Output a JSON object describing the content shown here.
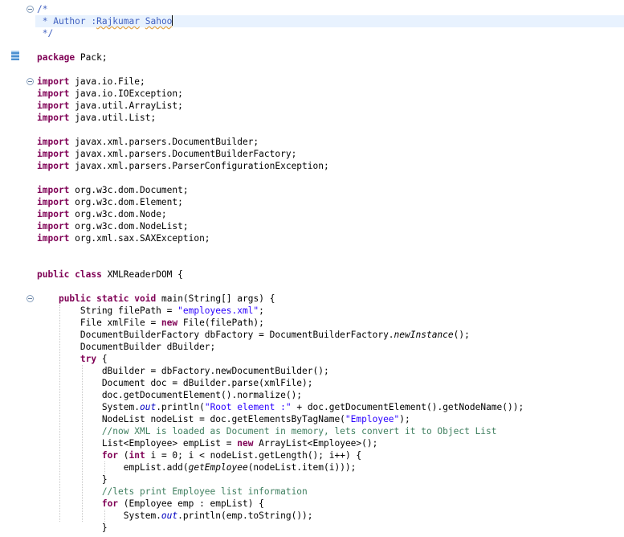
{
  "editor": {
    "lines": [
      {
        "segs": [
          {
            "t": "/*",
            "c": "jd"
          }
        ]
      },
      {
        "segs": [
          {
            "t": " * Author :",
            "c": "jd"
          },
          {
            "t": "Rajkumar",
            "c": "jd spell"
          },
          {
            "t": " ",
            "c": "jd"
          },
          {
            "t": "Sahoo",
            "c": "jd spell"
          }
        ],
        "current": true
      },
      {
        "segs": [
          {
            "t": " */",
            "c": "jd"
          }
        ]
      },
      {
        "segs": []
      },
      {
        "segs": [
          {
            "t": "package",
            "c": "kw"
          },
          {
            "t": " Pack;"
          }
        ]
      },
      {
        "segs": []
      },
      {
        "segs": [
          {
            "t": "import",
            "c": "kw"
          },
          {
            "t": " java.io.File;"
          }
        ]
      },
      {
        "segs": [
          {
            "t": "import",
            "c": "kw"
          },
          {
            "t": " java.io.IOException;"
          }
        ]
      },
      {
        "segs": [
          {
            "t": "import",
            "c": "kw"
          },
          {
            "t": " java.util.ArrayList;"
          }
        ]
      },
      {
        "segs": [
          {
            "t": "import",
            "c": "kw"
          },
          {
            "t": " java.util.List;"
          }
        ]
      },
      {
        "segs": []
      },
      {
        "segs": [
          {
            "t": "import",
            "c": "kw"
          },
          {
            "t": " javax.xml.parsers.DocumentBuilder;"
          }
        ]
      },
      {
        "segs": [
          {
            "t": "import",
            "c": "kw"
          },
          {
            "t": " javax.xml.parsers.DocumentBuilderFactory;"
          }
        ]
      },
      {
        "segs": [
          {
            "t": "import",
            "c": "kw"
          },
          {
            "t": " javax.xml.parsers.ParserConfigurationException;"
          }
        ]
      },
      {
        "segs": []
      },
      {
        "segs": [
          {
            "t": "import",
            "c": "kw"
          },
          {
            "t": " org.w3c.dom.Document;"
          }
        ]
      },
      {
        "segs": [
          {
            "t": "import",
            "c": "kw"
          },
          {
            "t": " org.w3c.dom.Element;"
          }
        ]
      },
      {
        "segs": [
          {
            "t": "import",
            "c": "kw"
          },
          {
            "t": " org.w3c.dom.Node;"
          }
        ]
      },
      {
        "segs": [
          {
            "t": "import",
            "c": "kw"
          },
          {
            "t": " org.w3c.dom.NodeList;"
          }
        ]
      },
      {
        "segs": [
          {
            "t": "import",
            "c": "kw"
          },
          {
            "t": " org.xml.sax.SAXException;"
          }
        ]
      },
      {
        "segs": []
      },
      {
        "segs": []
      },
      {
        "segs": [
          {
            "t": "public",
            "c": "kw"
          },
          {
            "t": " "
          },
          {
            "t": "class",
            "c": "kw"
          },
          {
            "t": " XMLReaderDOM {"
          }
        ]
      },
      {
        "segs": []
      },
      {
        "segs": [
          {
            "t": "    "
          },
          {
            "t": "public",
            "c": "kw"
          },
          {
            "t": " "
          },
          {
            "t": "static",
            "c": "kw"
          },
          {
            "t": " "
          },
          {
            "t": "void",
            "c": "kw"
          },
          {
            "t": " main(String[] args) {"
          }
        ]
      },
      {
        "segs": [
          {
            "t": "        String filePath = "
          },
          {
            "t": "\"employees.xml\"",
            "c": "str"
          },
          {
            "t": ";"
          }
        ]
      },
      {
        "segs": [
          {
            "t": "        File xmlFile = "
          },
          {
            "t": "new",
            "c": "kw"
          },
          {
            "t": " File(filePath);"
          }
        ]
      },
      {
        "segs": [
          {
            "t": "        DocumentBuilderFactory dbFactory = DocumentBuilderFactory."
          },
          {
            "t": "newInstance",
            "c": "it"
          },
          {
            "t": "();"
          }
        ]
      },
      {
        "segs": [
          {
            "t": "        DocumentBuilder dBuilder;"
          }
        ]
      },
      {
        "segs": [
          {
            "t": "        "
          },
          {
            "t": "try",
            "c": "kw"
          },
          {
            "t": " {"
          }
        ]
      },
      {
        "segs": [
          {
            "t": "            dBuilder = dbFactory.newDocumentBuilder();"
          }
        ]
      },
      {
        "segs": [
          {
            "t": "            Document doc = dBuilder.parse(xmlFile);"
          }
        ]
      },
      {
        "segs": [
          {
            "t": "            doc.getDocumentElement().normalize();"
          }
        ]
      },
      {
        "segs": [
          {
            "t": "            System."
          },
          {
            "t": "out",
            "c": "fld"
          },
          {
            "t": ".println("
          },
          {
            "t": "\"Root element :\"",
            "c": "str"
          },
          {
            "t": " + doc.getDocumentElement().getNodeName());"
          }
        ]
      },
      {
        "segs": [
          {
            "t": "            NodeList nodeList = doc.getElementsByTagName("
          },
          {
            "t": "\"Employee\"",
            "c": "str"
          },
          {
            "t": ");"
          }
        ]
      },
      {
        "segs": [
          {
            "t": "            //now XML is loaded as Document in memory, lets convert it to Object List",
            "c": "cm"
          }
        ]
      },
      {
        "segs": [
          {
            "t": "            List<Employee> empList = "
          },
          {
            "t": "new",
            "c": "kw"
          },
          {
            "t": " ArrayList<Employee>();"
          }
        ]
      },
      {
        "segs": [
          {
            "t": "            "
          },
          {
            "t": "for",
            "c": "kw"
          },
          {
            "t": " ("
          },
          {
            "t": "int",
            "c": "kw"
          },
          {
            "t": " i = 0; i < nodeList.getLength(); i++) {"
          }
        ]
      },
      {
        "segs": [
          {
            "t": "                empList.add("
          },
          {
            "t": "getEmployee",
            "c": "it"
          },
          {
            "t": "(nodeList.item(i)));"
          }
        ]
      },
      {
        "segs": [
          {
            "t": "            }"
          }
        ]
      },
      {
        "segs": [
          {
            "t": "            //lets print Employee list information",
            "c": "cm"
          }
        ]
      },
      {
        "segs": [
          {
            "t": "            "
          },
          {
            "t": "for",
            "c": "kw"
          },
          {
            "t": " (Employee emp : empList) {"
          }
        ]
      },
      {
        "segs": [
          {
            "t": "                System."
          },
          {
            "t": "out",
            "c": "fld"
          },
          {
            "t": ".println(emp.toString());"
          }
        ]
      },
      {
        "segs": [
          {
            "t": "            }"
          }
        ]
      }
    ],
    "fold_lines": [
      0,
      6,
      24
    ],
    "marker_lines": [
      4
    ],
    "caret_line": 1
  },
  "colors": {
    "background": "#ffffff",
    "current_line": "#e8f2fe",
    "keyword": "#7f0055",
    "string": "#2a00ff",
    "comment": "#3f7f5f",
    "javadoc": "#3f5fbf",
    "field": "#0000c0"
  }
}
